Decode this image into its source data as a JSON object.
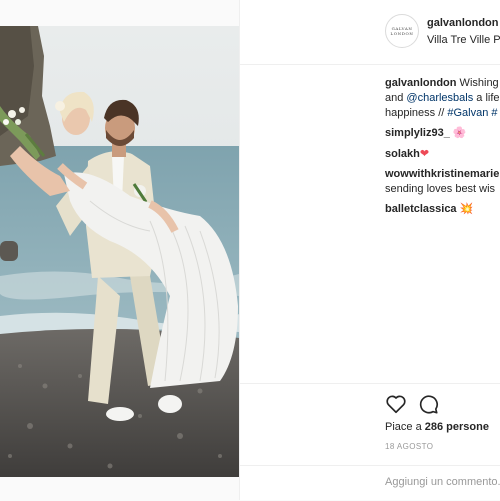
{
  "header": {
    "username": "galvanlondon",
    "location": "Villa Tre Ville P",
    "avatar_text": "GALVAN LONDON"
  },
  "caption": {
    "username": "galvanlondon",
    "text_line1": " Wishing",
    "line2_prefix": "and ",
    "mention": "@charlesbals",
    "line2_suffix": " a life",
    "line3_prefix": "happiness // ",
    "hashtag": "#Galvan #"
  },
  "comments": [
    {
      "username": "simplyliz93_",
      "emoji": "🌸"
    },
    {
      "username": "solakh",
      "emoji": "❤"
    },
    {
      "username": "wowwithkristinemarie",
      "text": "sending loves best wis"
    },
    {
      "username": "balletclassica",
      "emoji": "💥"
    }
  ],
  "actions": {
    "like_icon": "heart-icon",
    "comment_icon": "comment-bubble-icon",
    "likes_prefix": "Piace a ",
    "likes_count": "286 persone",
    "date": "18 AGOSTO"
  },
  "add_comment": {
    "placeholder": "Aggiungi un commento..."
  }
}
